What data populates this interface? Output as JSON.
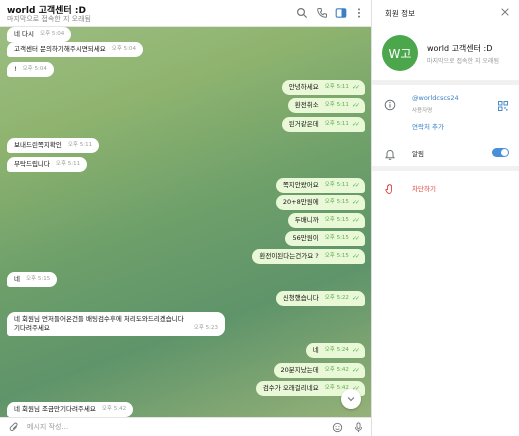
{
  "header": {
    "title": "world 고객센터 :D",
    "status": "마지막으로 접속한 지 오래됨"
  },
  "messages": [
    {
      "dir": "in",
      "text": "네 다시",
      "time": "오후 5:04"
    },
    {
      "dir": "in",
      "text": "고객센터 문의하기해주시면되세요",
      "time": "오후 5:04"
    },
    {
      "dir": "in",
      "text": "!",
      "time": "오후 5:04"
    },
    {
      "dir": "out",
      "text": "안녕하세요",
      "time": "오후 5:11"
    },
    {
      "dir": "out",
      "text": "환전취소",
      "time": "오후 5:11"
    },
    {
      "dir": "out",
      "text": "된거같은데",
      "time": "오후 5:11"
    },
    {
      "dir": "in",
      "text": "보내드린쪽지확인",
      "time": "오후 5:11"
    },
    {
      "dir": "in",
      "text": "부탁드립니다",
      "time": "오후 5:11"
    },
    {
      "dir": "out",
      "text": "쪽지안왔어요",
      "time": "오후 5:11"
    },
    {
      "dir": "out",
      "text": "20+8만원에",
      "time": "오후 5:15"
    },
    {
      "dir": "out",
      "text": "두배니까",
      "time": "오후 5:15"
    },
    {
      "dir": "out",
      "text": "56만원이",
      "time": "오후 5:15"
    },
    {
      "dir": "out",
      "text": "환전이된다는건가요 ?",
      "time": "오후 5:15"
    },
    {
      "dir": "in",
      "text": "네",
      "time": "오후 5:15"
    },
    {
      "dir": "out",
      "text": "신청했습니다",
      "time": "오후 5:22"
    },
    {
      "dir": "in",
      "line1": "네 회원님 먼저들어온건들 배팅검수후에 처리도와드리겠습니다",
      "line2": "기다려주세요",
      "time": "오후 5:23"
    },
    {
      "dir": "out",
      "text": "네",
      "time": "오후 5:24"
    },
    {
      "dir": "out",
      "text": "20분지났는데",
      "time": "오후 5:42"
    },
    {
      "dir": "out",
      "text": "검수가 오래걸리네요",
      "time": "오후 5:42"
    },
    {
      "dir": "in",
      "text": "네 회원님 조금만기다려주세요",
      "time": "오후 5:42"
    }
  ],
  "composer": {
    "placeholder": "메시지 작성..."
  },
  "info": {
    "title": "회원 정보",
    "avatar_text": "W고",
    "avatar_color": "#4ca74c",
    "name": "world 고객센터 :D",
    "status": "마지막으로 접속한 지 오래됨",
    "username": "@worldcscs24",
    "username_label": "사용자명",
    "add_contact": "연락처 추가",
    "notifications_label": "알림",
    "notifications_on": true,
    "block": "차단하기"
  },
  "colors": {
    "accent": "#3b80c7",
    "danger": "#e0443e",
    "outgoing_bubble": "#e9f8d7",
    "check": "#4fae4e"
  },
  "icons": {
    "header": [
      "search-icon",
      "phone-icon",
      "sidebar-icon",
      "more-icon"
    ],
    "composer": [
      "attach-icon",
      "emoji-icon",
      "mic-icon"
    ]
  }
}
